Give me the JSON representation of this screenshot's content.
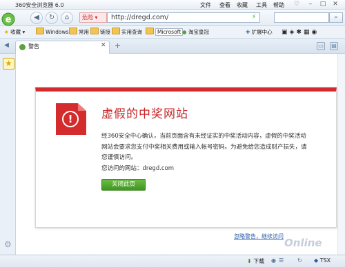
{
  "window": {
    "title": "360安全浏览器 6.0",
    "menu": [
      "文件",
      "查看",
      "收藏",
      "工具",
      "帮助"
    ]
  },
  "nav": {
    "danger_label": "危险",
    "url": "http://dregd.com/"
  },
  "bookmarks": {
    "favorites": "收藏",
    "items": [
      "Windows",
      "常用",
      "链接",
      "实用查询",
      "Microsoft",
      "淘宝皇冠"
    ],
    "extensions": "扩展中心"
  },
  "tab": {
    "title": "警告"
  },
  "warning": {
    "heading": "虚假的中奖网站",
    "body": "经360安全中心确认，当前页面含有未经证实的中奖活动内容，虚假的中奖活动网站会要求您支付中奖相关费用或输入帐号密码。为避免给您造成财产损失，请您谨慎访问。",
    "visited": "您访问的网站：dregd.com",
    "close_button": "关闭此页",
    "ignore_link": "忽略警告，继续访问"
  },
  "status": {
    "download": "下载",
    "speed": "TSX"
  },
  "colors": {
    "danger": "#d42c2c",
    "accent_green": "#4fa82a"
  },
  "watermark": "Online"
}
